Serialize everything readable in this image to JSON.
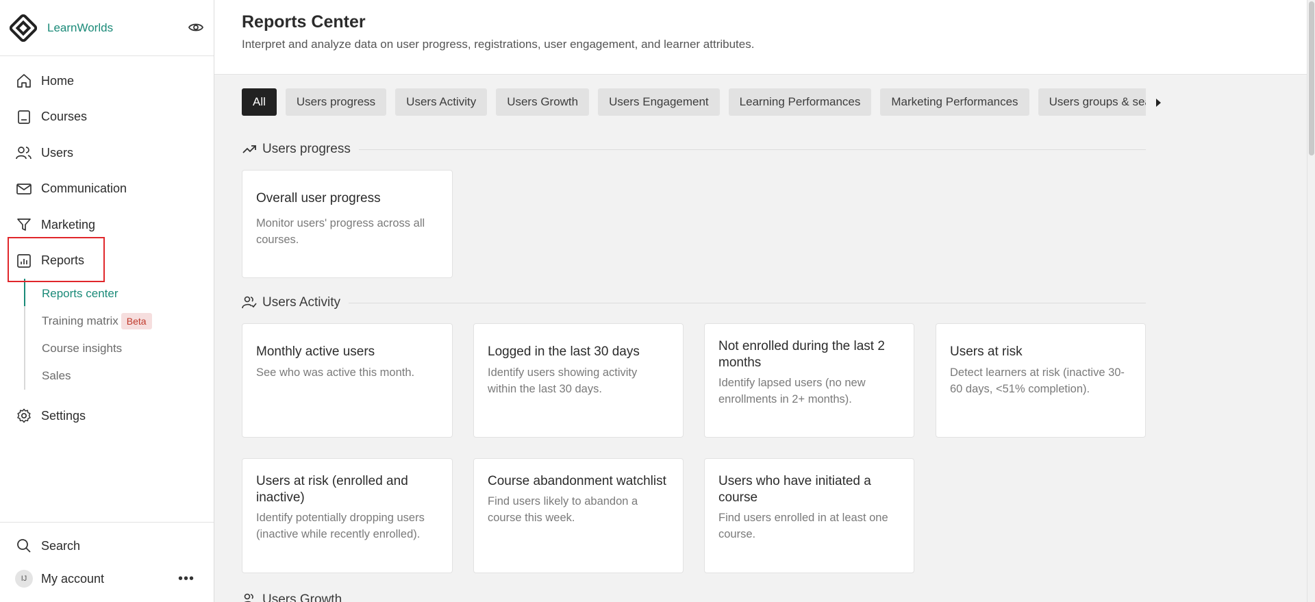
{
  "brand": {
    "name": "LearnWorlds"
  },
  "nav": [
    {
      "key": "home",
      "label": "Home",
      "icon": "home-icon"
    },
    {
      "key": "courses",
      "label": "Courses",
      "icon": "book-icon"
    },
    {
      "key": "users",
      "label": "Users",
      "icon": "users-icon"
    },
    {
      "key": "communication",
      "label": "Communication",
      "icon": "mail-icon"
    },
    {
      "key": "marketing",
      "label": "Marketing",
      "icon": "funnel-icon"
    },
    {
      "key": "reports",
      "label": "Reports",
      "icon": "chart-icon"
    }
  ],
  "subnav": [
    {
      "label": "Reports center",
      "active": true
    },
    {
      "label": "Training matrix",
      "badge": "Beta"
    },
    {
      "label": "Course insights"
    },
    {
      "label": "Sales"
    }
  ],
  "settings": {
    "label": "Settings"
  },
  "bottom": {
    "search_label": "Search",
    "account_label": "My account",
    "account_initials": "IJ"
  },
  "header": {
    "title": "Reports Center",
    "subtitle": "Interpret and analyze data on user progress, registrations, user engagement, and learner attributes."
  },
  "tabs": [
    {
      "label": "All",
      "active": true
    },
    {
      "label": "Users progress"
    },
    {
      "label": "Users Activity"
    },
    {
      "label": "Users Growth"
    },
    {
      "label": "Users Engagement"
    },
    {
      "label": "Learning Performances"
    },
    {
      "label": "Marketing Performances"
    },
    {
      "label": "Users groups & seats"
    }
  ],
  "sections": {
    "progress": {
      "title": "Users progress",
      "cards": [
        {
          "title": "Overall user progress",
          "desc": "Monitor users' progress across all courses."
        }
      ]
    },
    "activity": {
      "title": "Users Activity",
      "cards": [
        {
          "title": "Monthly active users",
          "desc": "See who was active this month."
        },
        {
          "title": "Logged in the last 30 days",
          "desc": "Identify users showing activity within the last 30 days."
        },
        {
          "title": "Not enrolled during the last 2 months",
          "desc": "Identify lapsed users (no new enrollments in 2+ months)."
        },
        {
          "title": "Users at risk",
          "desc": "Detect learners at risk (inactive 30-60 days, <51% completion)."
        },
        {
          "title": "Users at risk (enrolled and inactive)",
          "desc": "Identify potentially dropping users (inactive while recently enrolled)."
        },
        {
          "title": "Course abandonment watchlist",
          "desc": "Find users likely to abandon a course this week."
        },
        {
          "title": "Users who have initiated a course",
          "desc": "Find users enrolled in at least one course."
        }
      ]
    },
    "growth": {
      "title": "Users Growth"
    }
  },
  "colors": {
    "brand": "#1a8a78",
    "highlight": "#e0262a",
    "tab_active": "#222222"
  }
}
